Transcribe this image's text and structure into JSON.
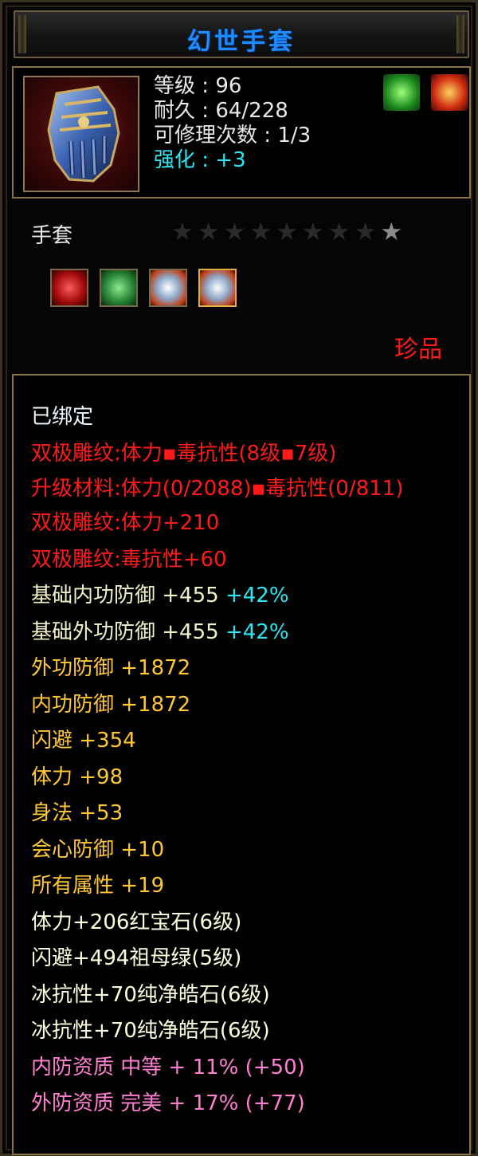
{
  "title": "幻世手套",
  "header": {
    "level_label": "等级",
    "level": "96",
    "durability_label": "耐久",
    "durability": "64/228",
    "repair_label": "可修理次数",
    "repair": "1/3",
    "enhance_label": "强化",
    "enhance": "+3",
    "buff_icons": [
      "green-feather-buff-icon",
      "red-flame-buff-icon"
    ]
  },
  "item_type": "手套",
  "stars": {
    "total": 9,
    "lit": 1
  },
  "gems": [
    "red-gem-icon",
    "green-gem-icon",
    "white-gem-icon",
    "white-gem-icon"
  ],
  "rarity": "珍品",
  "attributes": [
    {
      "text": "已绑定",
      "color": "white"
    },
    {
      "text": "双极雕纹:体力▪毒抗性(8级▪7级)",
      "color": "red"
    },
    {
      "text": "升级材料:体力(0/2088)▪毒抗性(0/811)",
      "color": "red"
    },
    {
      "text": "双极雕纹:体力+210",
      "color": "red"
    },
    {
      "text": "双极雕纹:毒抗性+60",
      "color": "red"
    },
    {
      "text": "基础内功防御 +455",
      "extra": "+42%",
      "color": "cream"
    },
    {
      "text": "基础外功防御 +455",
      "extra": "+42%",
      "color": "cream"
    },
    {
      "text": "外功防御 +1872",
      "color": "yellow"
    },
    {
      "text": "内功防御 +1872",
      "color": "yellow"
    },
    {
      "text": "闪避 +354",
      "color": "yellow"
    },
    {
      "text": "体力 +98",
      "color": "yellow"
    },
    {
      "text": "身法 +53",
      "color": "yellow"
    },
    {
      "text": "会心防御 +10",
      "color": "yellow"
    },
    {
      "text": "所有属性 +19",
      "color": "yellow"
    },
    {
      "text": "体力+206红宝石(6级)",
      "color": "light"
    },
    {
      "text": "闪避+494祖母绿(5级)",
      "color": "light"
    },
    {
      "text": "冰抗性+70纯净皓石(6级)",
      "color": "light"
    },
    {
      "text": "冰抗性+70纯净皓石(6级)",
      "color": "light"
    },
    {
      "text": "内防资质 中等 + 11% (+50)",
      "color": "pink"
    },
    {
      "text": "外防资质 完美 + 17% (+77)",
      "color": "pink"
    }
  ],
  "colors": {
    "title": "#1e8cff",
    "red": "#ff1a1a",
    "cyan": "#2ee6f2",
    "yellow": "#ffc832",
    "pink": "#ff80d0",
    "border": "#8a7444"
  }
}
